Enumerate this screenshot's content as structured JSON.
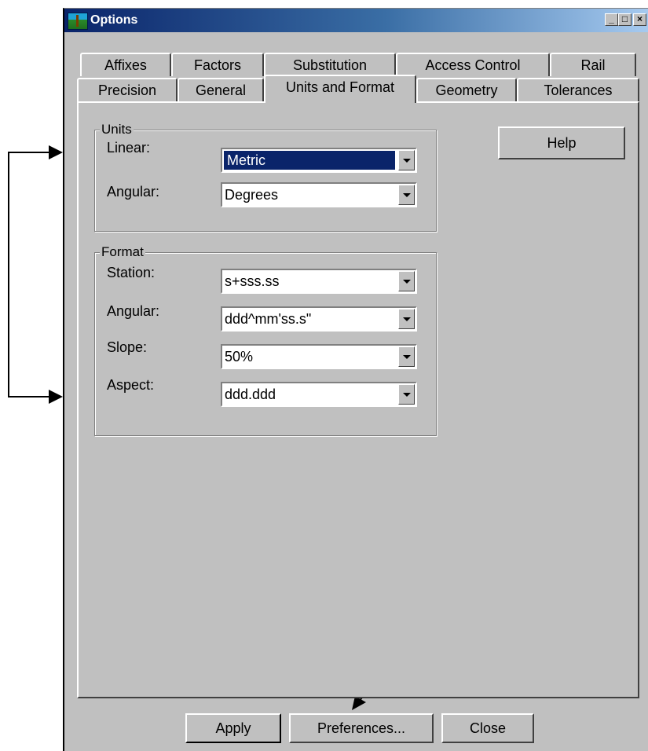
{
  "window": {
    "title": "Options"
  },
  "titlebar_buttons": {
    "minimize": "_",
    "maximize": "□",
    "close": "×"
  },
  "tabs_back_row": [
    "Affixes",
    "Factors",
    "Substitution",
    "Access Control",
    "Rail"
  ],
  "tabs_front_row": [
    "Precision",
    "General",
    "Units and Format",
    "Geometry",
    "Tolerances"
  ],
  "active_tab": "Units and Format",
  "units_group": {
    "label": "Units",
    "linear_label": "Linear:",
    "linear_value": "Metric",
    "angular_label": "Angular:",
    "angular_value": "Degrees"
  },
  "format_group": {
    "label": "Format",
    "station_label": "Station:",
    "station_value": "s+sss.ss",
    "angular_label": "Angular:",
    "angular_value": "ddd^mm'ss.s\"",
    "slope_label": "Slope:",
    "slope_value": "50%",
    "aspect_label": "Aspect:",
    "aspect_value": "ddd.ddd"
  },
  "buttons": {
    "help": "Help",
    "apply": "Apply",
    "preferences": "Preferences...",
    "close": "Close"
  }
}
